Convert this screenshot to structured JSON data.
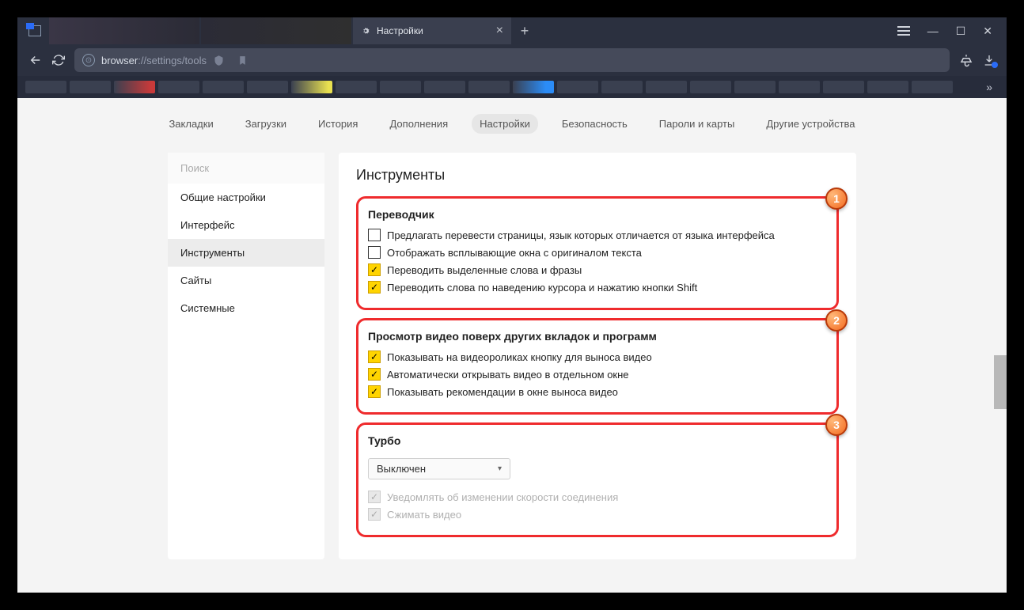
{
  "tab": {
    "title": "Настройки"
  },
  "url": {
    "protocol": "browser",
    "rest": "://settings/tools"
  },
  "topTabs": [
    "Закладки",
    "Загрузки",
    "История",
    "Дополнения",
    "Настройки",
    "Безопасность",
    "Пароли и карты",
    "Другие устройства"
  ],
  "activeTopTab": 4,
  "sidebar": {
    "searchPlaceholder": "Поиск",
    "items": [
      "Общие настройки",
      "Интерфейс",
      "Инструменты",
      "Сайты",
      "Системные"
    ],
    "activeIndex": 2
  },
  "main": {
    "heading": "Инструменты",
    "blocks": [
      {
        "badge": "1",
        "title": "Переводчик",
        "checks": [
          {
            "checked": false,
            "disabled": false,
            "label": "Предлагать перевести страницы, язык которых отличается от языка интерфейса"
          },
          {
            "checked": false,
            "disabled": false,
            "label": "Отображать всплывающие окна с оригиналом текста"
          },
          {
            "checked": true,
            "disabled": false,
            "label": "Переводить выделенные слова и фразы"
          },
          {
            "checked": true,
            "disabled": false,
            "label": "Переводить слова по наведению курсора и нажатию кнопки Shift"
          }
        ]
      },
      {
        "badge": "2",
        "title": "Просмотр видео поверх других вкладок и программ",
        "checks": [
          {
            "checked": true,
            "disabled": false,
            "label": "Показывать на видеороликах кнопку для выноса видео"
          },
          {
            "checked": true,
            "disabled": false,
            "label": "Автоматически открывать видео в отдельном окне"
          },
          {
            "checked": true,
            "disabled": false,
            "label": "Показывать рекомендации в окне выноса видео"
          }
        ]
      },
      {
        "badge": "3",
        "title": "Турбо",
        "select": "Выключен",
        "checks": [
          {
            "checked": true,
            "disabled": true,
            "label": "Уведомлять об изменении скорости соединения"
          },
          {
            "checked": true,
            "disabled": true,
            "label": "Сжимать видео"
          }
        ]
      }
    ]
  }
}
